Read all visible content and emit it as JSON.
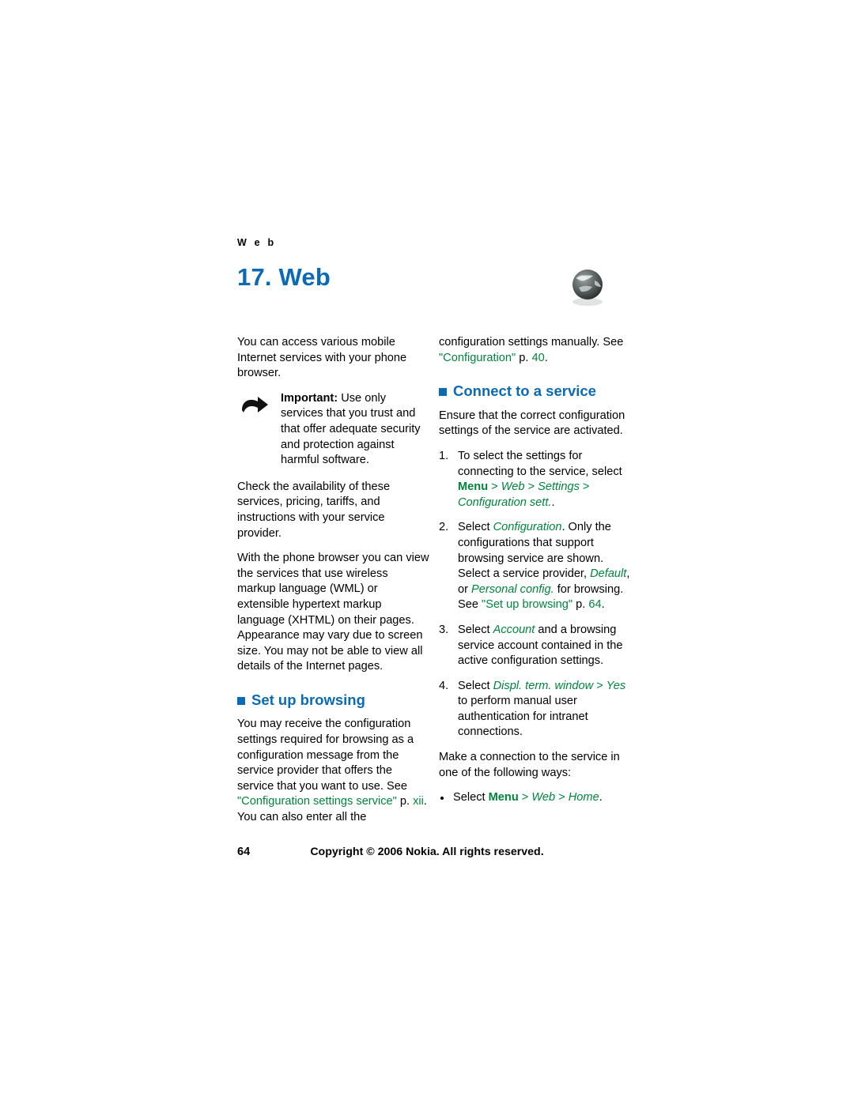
{
  "page": {
    "running_head": "W e b",
    "chapter_title": "17. Web",
    "chapter_icon": "globe-icon",
    "page_number": "64",
    "copyright": "Copyright © 2006 Nokia. All rights reserved.",
    "accent_color": "#0a6ab5",
    "link_color": "#00843d"
  },
  "left_column": {
    "intro": "You can access various mobile Internet services with your phone browser.",
    "note": {
      "icon": "important-note-icon",
      "label": "Important:",
      "text": " Use only services that you trust and that offer adequate security and protection against harmful software."
    },
    "para_check": "Check the availability of these services, pricing, tariffs, and instructions with your service provider.",
    "para_browser": "With the phone browser you can view the services that use wireless markup language (WML) or extensible hypertext markup language (XHTML) on their pages. Appearance may vary due to screen size. You may not be able to view all details of the Internet pages.",
    "heading_setup": "Set up browsing",
    "setup_text_1": "You may receive the configuration settings required for browsing as a configuration message from the service provider that offers the service that you want to use. See ",
    "setup_link": "\"Configuration settings service\"",
    "setup_text_2": " p. ",
    "setup_page_ref": "xii",
    "setup_text_3": ". You can also enter all the"
  },
  "right_column": {
    "continued_text_1": "configuration settings manually. See ",
    "continued_link": "\"Configuration\"",
    "continued_text_2": " p. ",
    "continued_page_ref": "40",
    "continued_text_3": ".",
    "heading_connect": "Connect to a service",
    "ensure_text": "Ensure that the correct configuration settings of the service are activated.",
    "steps": [
      {
        "num": "1.",
        "text_1": "To select the settings for connecting to the service, select ",
        "path_bold": "Menu",
        "sep1": " > ",
        "path_italic_1": "Web",
        "sep2": " > ",
        "path_italic_2": "Settings",
        "sep3": " > ",
        "path_italic_3": "Configuration sett.",
        "text_2": "."
      },
      {
        "num": "2.",
        "text_1": "Select ",
        "em_1": "Configuration",
        "text_2": ". Only the configurations that support browsing service are shown. Select a service provider, ",
        "em_2": "Default",
        "text_3": ", or ",
        "em_3": "Personal config.",
        "text_4": " for browsing. See ",
        "link": "\"Set up browsing\"",
        "text_5": " p. ",
        "page_ref": "64",
        "text_6": "."
      },
      {
        "num": "3.",
        "text_1": "Select ",
        "em_1": "Account",
        "text_2": " and a browsing service account contained in the active configuration settings."
      },
      {
        "num": "4.",
        "text_1": "Select ",
        "em_1": "Displ. term. window",
        "sep1": " > ",
        "em_2": "Yes",
        "text_2": " to perform manual user authentication for intranet connections."
      }
    ],
    "make_connection": "Make a connection to the service in one of the following ways:",
    "bullets": [
      {
        "text_1": "Select ",
        "b_1": "Menu",
        "sep1": " > ",
        "em_1": "Web",
        "sep2": " > ",
        "em_2": "Home",
        "text_2": "."
      }
    ]
  }
}
